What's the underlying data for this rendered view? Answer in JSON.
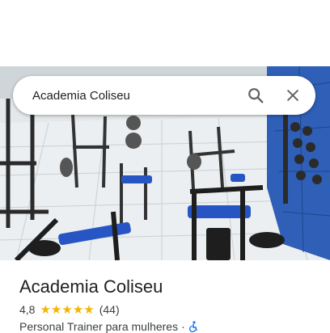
{
  "search": {
    "query": "Academia Coliseu",
    "search_icon": "search-icon",
    "close_icon": "close-icon"
  },
  "hero": {
    "image": "photo of gym interior with weight machines and blue benches"
  },
  "place": {
    "name": "Academia Coliseu",
    "rating": "4,8",
    "stars": 5,
    "review_count": "(44)",
    "category": "Personal Trainer para mulheres",
    "separator": "·",
    "accessibility_icon": "wheelchair-icon"
  },
  "colors": {
    "star": "#f4b400",
    "accessibility": "#1a73e8",
    "text": "#202124"
  }
}
